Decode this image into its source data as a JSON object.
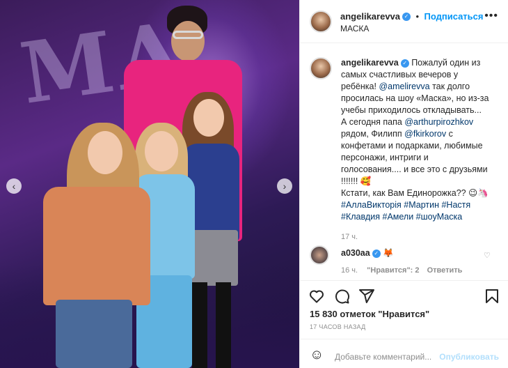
{
  "post": {
    "username": "angelikarevva",
    "follow_label": "Подписаться",
    "location": "МАСКА",
    "separator": "•",
    "more_label": "•••",
    "caption": {
      "line1": "Пожалуй один из",
      "line2": "самых счастливых вечеров у",
      "line3": "ребёнка!",
      "mention1": "@amelirevva",
      "line3b": "так долго",
      "line4": "просилась на шоу «Маска», но из-за",
      "line5": "учебы приходилось откладывать...",
      "line6": "А сегодня папа",
      "mention2": "@arthurpirozhkov",
      "line7": "рядом, Филипп",
      "mention3": "@fkirkorov",
      "line7b": "с",
      "line8": "конфетами и подарками, любимые",
      "line9": "персонажи, интриги и",
      "line10": "голосования.... и все это с друзьями",
      "line11": "!!!!!!! 🥰",
      "line12": "Кстати, как Вам Единорожка?? 😉🦄",
      "tags1": "#АллаВикторія #Мартин #Настя",
      "tags2": "#Клавдия #Амели #шоуМаска"
    },
    "caption_time": "17 ч.",
    "likes_text": "15 830 отметок \"Нравится\"",
    "posted_ago": "17 ЧАСОВ НАЗАД"
  },
  "comment": {
    "username": "a030aa",
    "emoji": "🦊",
    "time": "16 ч.",
    "likes": "\"Нравится\": 2",
    "reply_label": "Ответить"
  },
  "add_comment": {
    "placeholder": "Добавьте комментарий...",
    "publish_label": "Опубликовать",
    "emoji_icon": "☺"
  },
  "nav": {
    "prev": "‹",
    "next": "›"
  },
  "colors": {
    "accent": "#0095f6",
    "verified": "#3897f0",
    "link": "#00376b"
  }
}
